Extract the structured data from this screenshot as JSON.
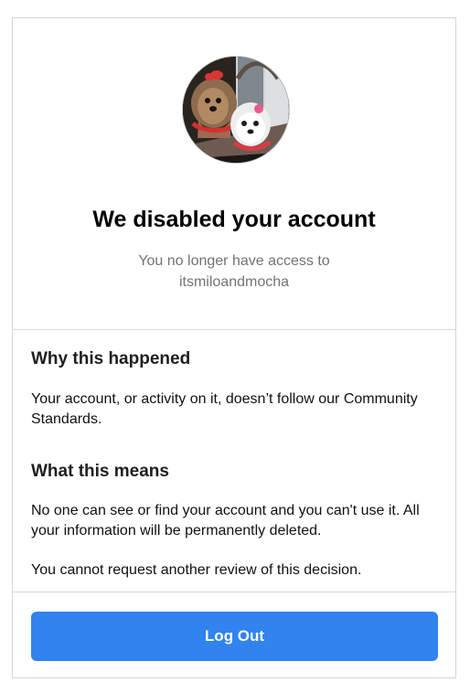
{
  "header": {
    "title": "We disabled your account",
    "subtitle": "You no longer have access to itsmiloandmocha"
  },
  "profile": {
    "avatar_icon": "profile-photo-dogs"
  },
  "why": {
    "heading": "Why this happened",
    "text": "Your account, or activity on it, doesn’t follow our Community Standards."
  },
  "means": {
    "heading": "What this means",
    "text1": "No one can see or find your account and you can't use it. All your information will be permanently deleted.",
    "text2": "You cannot request another review of this decision."
  },
  "actions": {
    "logout_label": "Log Out"
  },
  "colors": {
    "button": "#3183ee",
    "muted_text": "#737373",
    "border": "#d6d6d6"
  }
}
